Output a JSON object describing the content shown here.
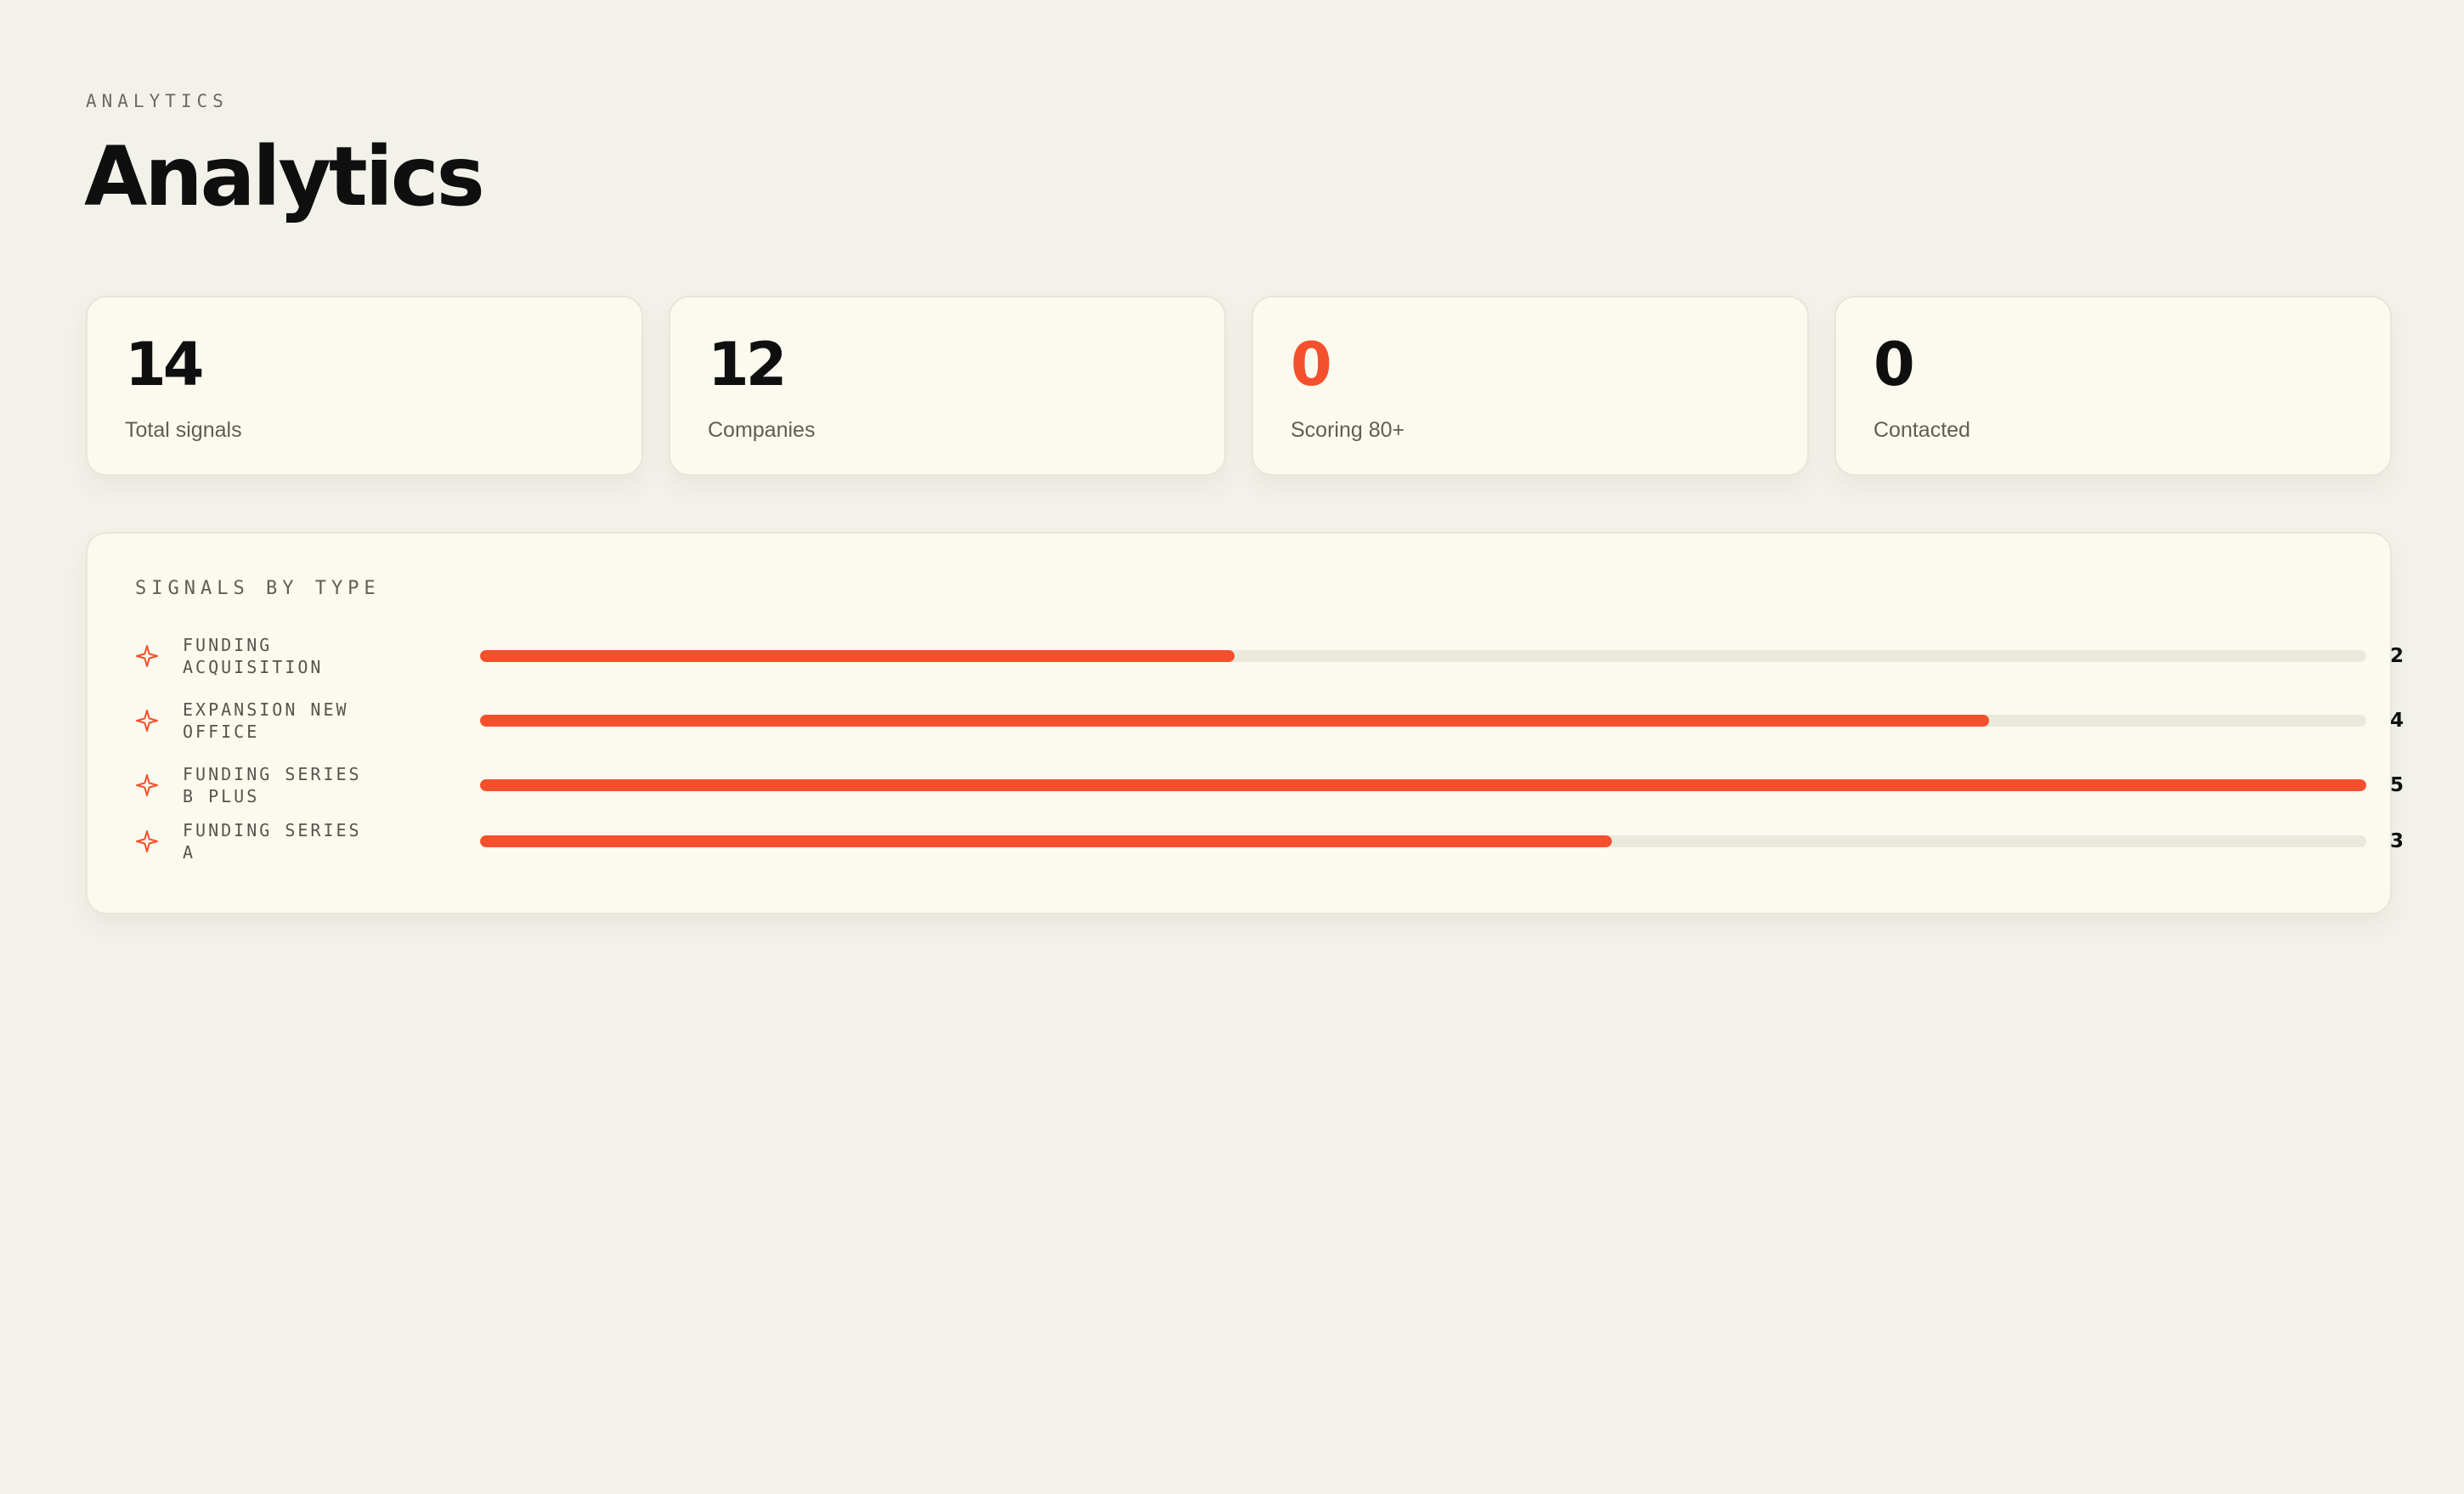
{
  "header": {
    "eyebrow": "ANALYTICS",
    "title": "Analytics"
  },
  "stats": [
    {
      "value": "14",
      "label": "Total signals"
    },
    {
      "value": "12",
      "label": "Companies"
    },
    {
      "value": "0",
      "label": "Scoring 80+"
    },
    {
      "value": "0",
      "label": "Contacted"
    }
  ],
  "signals_by_type": {
    "title": "SIGNALS BY TYPE",
    "icon": "sparkle-icon",
    "max": 5,
    "rows": [
      {
        "label": "FUNDING ACQUISITION",
        "count": 2
      },
      {
        "label": "EXPANSION NEW OFFICE",
        "count": 4
      },
      {
        "label": "FUNDING SERIES B PLUS",
        "count": 5
      },
      {
        "label": "FUNDING SERIES A",
        "count": 3
      }
    ]
  },
  "colors": {
    "accent": "#f4502d",
    "background": "#f3f2ea",
    "card": "#fcfaef",
    "track": "#ebe8dc"
  }
}
